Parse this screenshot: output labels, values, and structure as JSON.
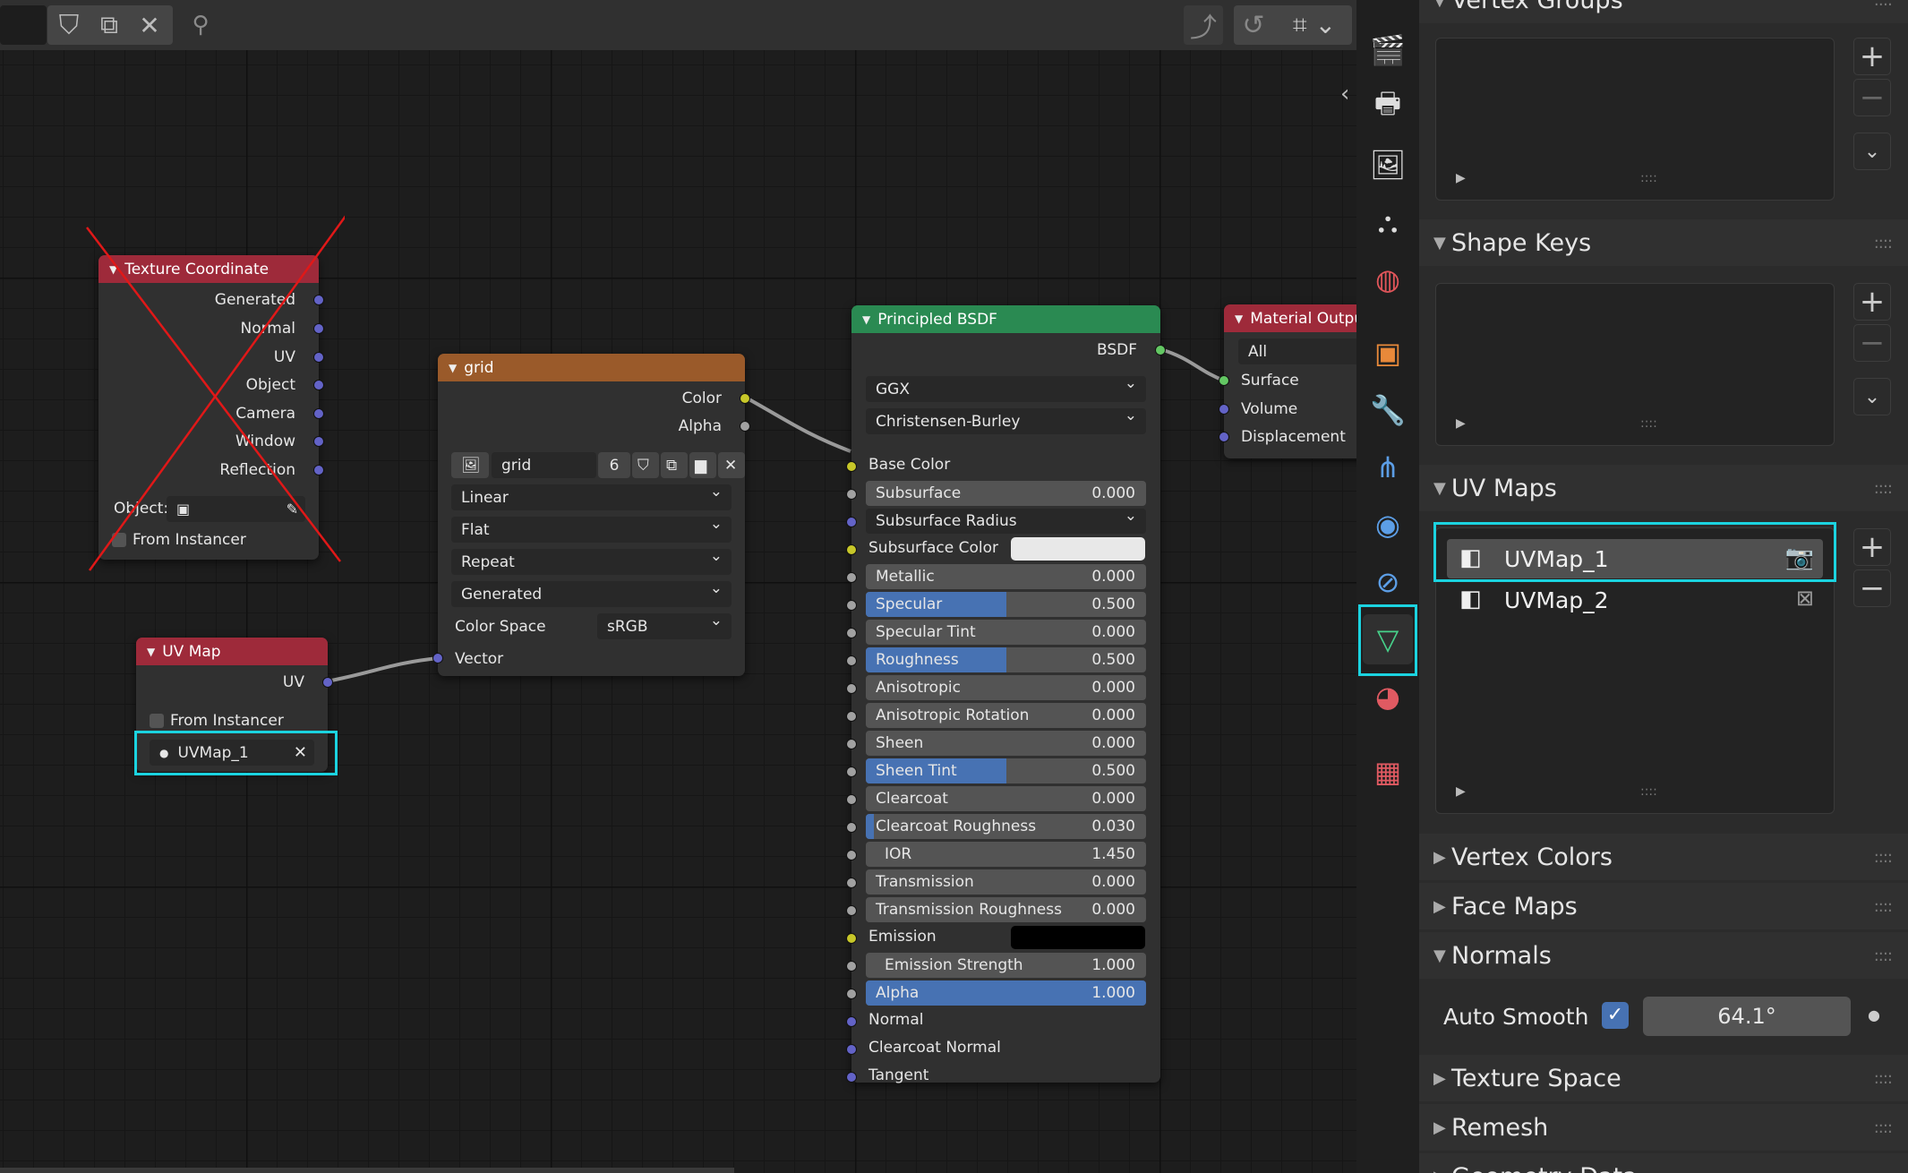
{
  "header": {
    "icons": [
      "shield-icon",
      "duplicate-icon",
      "close-icon",
      "pin-icon",
      "parent-icon",
      "snap-icon",
      "grid-snap-icon"
    ]
  },
  "nodes": {
    "texture_coordinate": {
      "title": "Texture Coordinate",
      "outputs": [
        "Generated",
        "Normal",
        "UV",
        "Object",
        "Camera",
        "Window",
        "Reflection"
      ],
      "object_label": "Object:",
      "from_instancer": "From Instancer"
    },
    "uv_map": {
      "title": "UV Map",
      "output": "UV",
      "from_instancer": "From Instancer",
      "map_value": "UVMap_1"
    },
    "grid": {
      "title": "grid",
      "outputs": [
        "Color",
        "Alpha"
      ],
      "image_name": "grid",
      "users": "6",
      "interpolation": "Linear",
      "projection": "Flat",
      "extension": "Repeat",
      "source": "Generated",
      "color_space_label": "Color Space",
      "color_space": "sRGB",
      "input": "Vector"
    },
    "principled": {
      "title": "Principled BSDF",
      "output": "BSDF",
      "distribution": "GGX",
      "subsurface_method": "Christensen-Burley",
      "base_color": "Base Color",
      "subsurface": {
        "label": "Subsurface",
        "value": "0.000"
      },
      "subsurface_radius": "Subsurface Radius",
      "subsurface_color": "Subsurface Color",
      "metallic": {
        "label": "Metallic",
        "value": "0.000"
      },
      "specular": {
        "label": "Specular",
        "value": "0.500",
        "fill": 0.5
      },
      "specular_tint": {
        "label": "Specular Tint",
        "value": "0.000"
      },
      "roughness": {
        "label": "Roughness",
        "value": "0.500",
        "fill": 0.5
      },
      "anisotropic": {
        "label": "Anisotropic",
        "value": "0.000"
      },
      "anisotropic_rotation": {
        "label": "Anisotropic Rotation",
        "value": "0.000"
      },
      "sheen": {
        "label": "Sheen",
        "value": "0.000"
      },
      "sheen_tint": {
        "label": "Sheen Tint",
        "value": "0.500",
        "fill": 0.5
      },
      "clearcoat": {
        "label": "Clearcoat",
        "value": "0.000"
      },
      "clearcoat_roughness": {
        "label": "Clearcoat Roughness",
        "value": "0.030",
        "fill": 0.03
      },
      "ior": {
        "label": "IOR",
        "value": "1.450"
      },
      "transmission": {
        "label": "Transmission",
        "value": "0.000"
      },
      "transmission_roughness": {
        "label": "Transmission Roughness",
        "value": "0.000"
      },
      "emission": "Emission",
      "emission_strength": {
        "label": "Emission Strength",
        "value": "1.000"
      },
      "alpha": {
        "label": "Alpha",
        "value": "1.000",
        "fill": 1.0
      },
      "normal": "Normal",
      "clearcoat_normal": "Clearcoat Normal",
      "tangent": "Tangent"
    },
    "material_output": {
      "title": "Material Outpu",
      "target": "All",
      "inputs": [
        "Surface",
        "Volume",
        "Displacement"
      ]
    }
  },
  "properties": {
    "vertex_groups": "Vertex Groups",
    "shape_keys": "Shape Keys",
    "uv_maps": "UV Maps",
    "uv_items": [
      "UVMap_1",
      "UVMap_2"
    ],
    "vertex_colors": "Vertex Colors",
    "face_maps": "Face Maps",
    "normals": "Normals",
    "auto_smooth_label": "Auto Smooth",
    "auto_smooth_angle": "64.1°",
    "texture_space": "Texture Space",
    "remesh": "Remesh",
    "geometry_data": "Geometry Data"
  },
  "colors": {
    "highlight": "#1bd3e0",
    "input_node_header": "#9e2a3a",
    "texture_node_header": "#9a5a2a",
    "shader_node_header": "#2a8a52",
    "slider_fill": "#4772b3"
  }
}
